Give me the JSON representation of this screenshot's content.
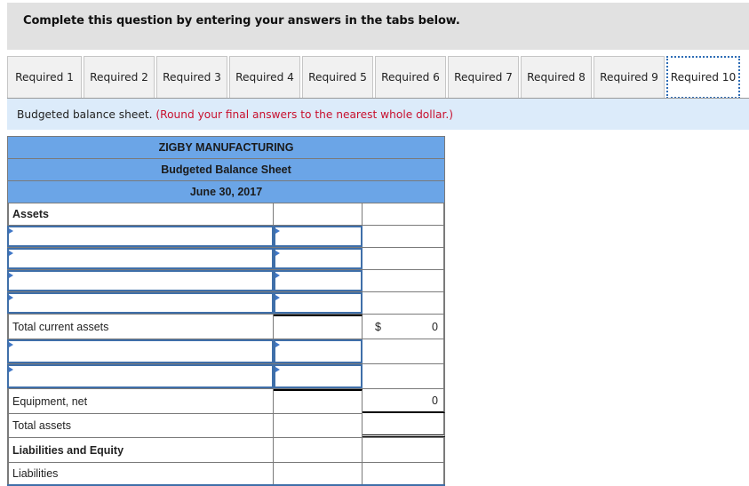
{
  "header": {
    "title": "Complete this question by entering your answers in the tabs below."
  },
  "tabs": [
    {
      "label": "Required 1",
      "active": false
    },
    {
      "label": "Required 2",
      "active": false
    },
    {
      "label": "Required 3",
      "active": false
    },
    {
      "label": "Required 4",
      "active": false
    },
    {
      "label": "Required 5",
      "active": false
    },
    {
      "label": "Required 6",
      "active": false
    },
    {
      "label": "Required 7",
      "active": false
    },
    {
      "label": "Required 8",
      "active": false
    },
    {
      "label": "Required 9",
      "active": false
    },
    {
      "label": "Required 10",
      "active": true
    }
  ],
  "instruction": {
    "text": "Budgeted balance sheet.",
    "note": "(Round your final answers to the nearest whole dollar.)"
  },
  "sheet": {
    "company": "ZIGBY MANUFACTURING",
    "title": "Budgeted Balance Sheet",
    "date": "June 30, 2017",
    "assets_label": "Assets",
    "total_current_assets": {
      "label": "Total current assets",
      "currency": "$",
      "value": "0"
    },
    "equipment_net": {
      "label": "Equipment, net",
      "value": "0"
    },
    "total_assets": {
      "label": "Total assets",
      "value": ""
    },
    "liabilities_equity_label": "Liabilities and Equity",
    "liabilities_label": "Liabilities",
    "inputs": {
      "current_asset_rows": [
        {
          "account": "",
          "amount": ""
        },
        {
          "account": "",
          "amount": ""
        },
        {
          "account": "",
          "amount": ""
        },
        {
          "account": "",
          "amount": ""
        }
      ],
      "noncurrent_rows": [
        {
          "account": "",
          "amount": ""
        },
        {
          "account": "",
          "amount": ""
        }
      ]
    }
  }
}
